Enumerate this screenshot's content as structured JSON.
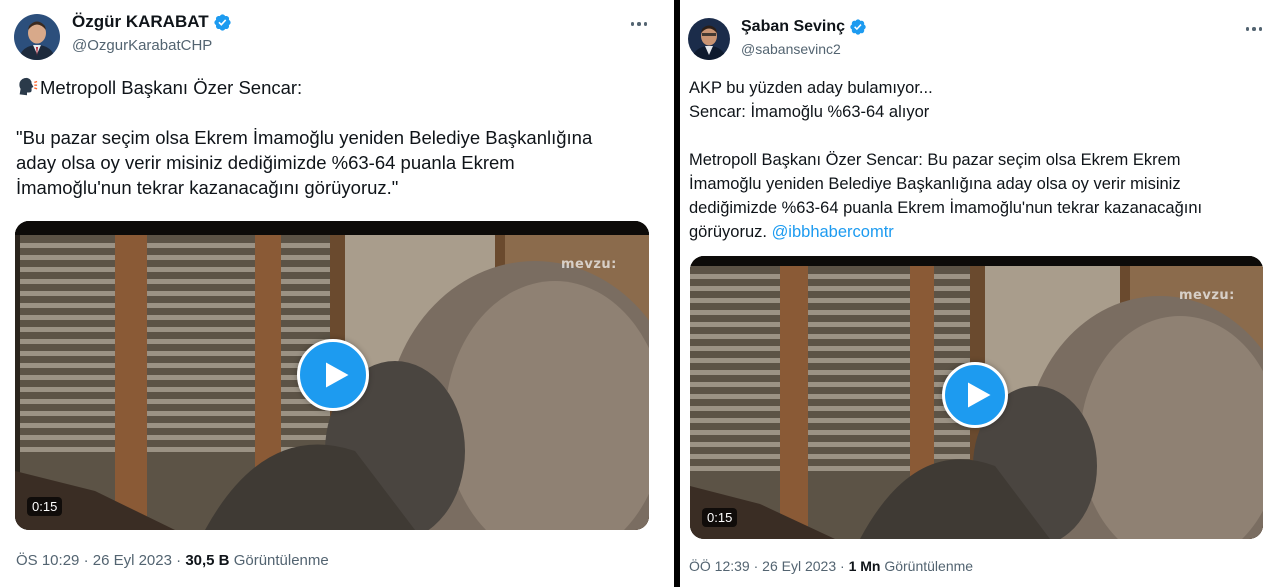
{
  "left_tweet": {
    "author_name": "Özgür KARABAT",
    "author_handle": "@OzgurKarabatCHP",
    "line1_text": "Metropoll Başkanı Özer Sencar:",
    "quote_lines": [
      "\"Bu pazar seçim olsa Ekrem İmamoğlu yeniden Belediye Başkanlığına",
      "aday olsa oy verir misiniz dediğimizde %63-64 puanla Ekrem",
      "İmamoğlu'nun tekrar kazanacağını görüyoruz.\""
    ],
    "video": {
      "watermark": "mevzu:",
      "duration": "0:15"
    },
    "time": "ÖS 10:29",
    "date": "26 Eyl 2023",
    "views_count": "30,5 B",
    "views_label": "Görüntülenme",
    "icons": [
      "speaking-head-icon",
      "verified-badge-icon",
      "more-options-icon",
      "play-icon"
    ]
  },
  "right_tweet": {
    "author_name": "Şaban Sevinç",
    "author_handle": "@sabansevinc2",
    "lines_a": [
      "AKP bu yüzden aday bulamıyor...",
      "Sencar: İmamoğlu %63-64 alıyor"
    ],
    "lines_b": [
      "Metropoll Başkanı Özer Sencar: Bu pazar seçim olsa Ekrem Ekrem",
      "İmamoğlu yeniden Belediye Başkanlığına aday olsa oy verir misiniz",
      "dediğimizde %63-64 puanla Ekrem İmamoğlu'nun tekrar kazanacağını"
    ],
    "last_line_text": "görüyoruz.",
    "mention": "@ibbhabercomtr",
    "video": {
      "watermark": "mevzu:",
      "duration": "0:15"
    },
    "time": "ÖÖ 12:39",
    "date": "26 Eyl 2023",
    "views_count": "1 Mn",
    "views_label": "Görüntülenme",
    "icons": [
      "verified-badge-icon",
      "more-options-icon",
      "play-icon"
    ]
  },
  "colors": {
    "accent": "#1d9bf0",
    "secondary_text": "#536471",
    "primary_text": "#0f1419"
  }
}
